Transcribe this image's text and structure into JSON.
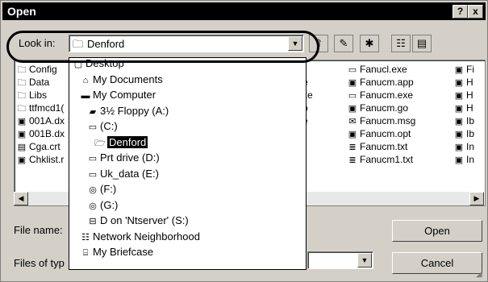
{
  "window": {
    "title": "Open",
    "help_button": "?",
    "close_button": "x"
  },
  "look_in": {
    "label": "Look in:",
    "value": "Denford"
  },
  "toolbar_icons": [
    "up-one-level-icon",
    "create-new-folder-icon",
    "new-item-icon",
    "list-view-icon",
    "details-view-icon"
  ],
  "files_left": [
    {
      "icon": "folder-icon",
      "name": "Config"
    },
    {
      "icon": "folder-icon",
      "name": "Data"
    },
    {
      "icon": "folder-icon",
      "name": "Libs"
    },
    {
      "icon": "folder-icon",
      "name": "ttfmcd1("
    },
    {
      "icon": "file-icon",
      "name": "001A.dx"
    },
    {
      "icon": "file-icon",
      "name": "001B.dx"
    },
    {
      "icon": "certificate-icon",
      "name": "Cga.crt"
    },
    {
      "icon": "file-icon",
      "name": "Chklist.r"
    }
  ],
  "files_col2_fragments": [
    "e",
    "xe",
    "o",
    "e"
  ],
  "files_right": [
    {
      "icon": "exe-icon",
      "name": "Fanucl.exe"
    },
    {
      "icon": "file-icon",
      "name": "Fanucm.app"
    },
    {
      "icon": "exe-icon",
      "name": "Fanucm.exe"
    },
    {
      "icon": "file-icon",
      "name": "Fanucm.go"
    },
    {
      "icon": "mail-icon",
      "name": "Fanucm.msg"
    },
    {
      "icon": "file-icon",
      "name": "Fanucm.opt"
    },
    {
      "icon": "text-file-icon",
      "name": "Fanucm.txt"
    },
    {
      "icon": "text-file-icon",
      "name": "Fanucm1.txt"
    }
  ],
  "files_far": [
    "Fi",
    "H",
    "H",
    "H",
    "Ib",
    "Ib",
    "In",
    "In"
  ],
  "dropdown": [
    {
      "icon": "desktop-icon",
      "name": "Desktop",
      "indent": 0
    },
    {
      "icon": "my-documents-icon",
      "name": "My Documents",
      "indent": 1
    },
    {
      "icon": "my-computer-icon",
      "name": "My Computer",
      "indent": 1
    },
    {
      "icon": "floppy-icon",
      "name": "3½ Floppy (A:)",
      "indent": 2
    },
    {
      "icon": "drive-icon",
      "name": "(C:)",
      "indent": 2
    },
    {
      "icon": "open-folder-icon",
      "name": "Denford",
      "indent": 3,
      "selected": true
    },
    {
      "icon": "drive-icon",
      "name": "Prt drive (D:)",
      "indent": 2
    },
    {
      "icon": "drive-icon",
      "name": "Uk_data (E:)",
      "indent": 2
    },
    {
      "icon": "cdrom-icon",
      "name": "(F:)",
      "indent": 2
    },
    {
      "icon": "cdrom-icon",
      "name": "(G:)",
      "indent": 2
    },
    {
      "icon": "network-drive-icon",
      "name": "D on 'Ntserver' (S:)",
      "indent": 2
    },
    {
      "icon": "network-neighborhood-icon",
      "name": "Network Neighborhood",
      "indent": 1
    },
    {
      "icon": "briefcase-icon",
      "name": "My Briefcase",
      "indent": 1
    }
  ],
  "file_name": {
    "label": "File name:",
    "value": ""
  },
  "files_of_type": {
    "label": "Files of typ",
    "value": ""
  },
  "buttons": {
    "open": "Open",
    "cancel": "Cancel"
  }
}
